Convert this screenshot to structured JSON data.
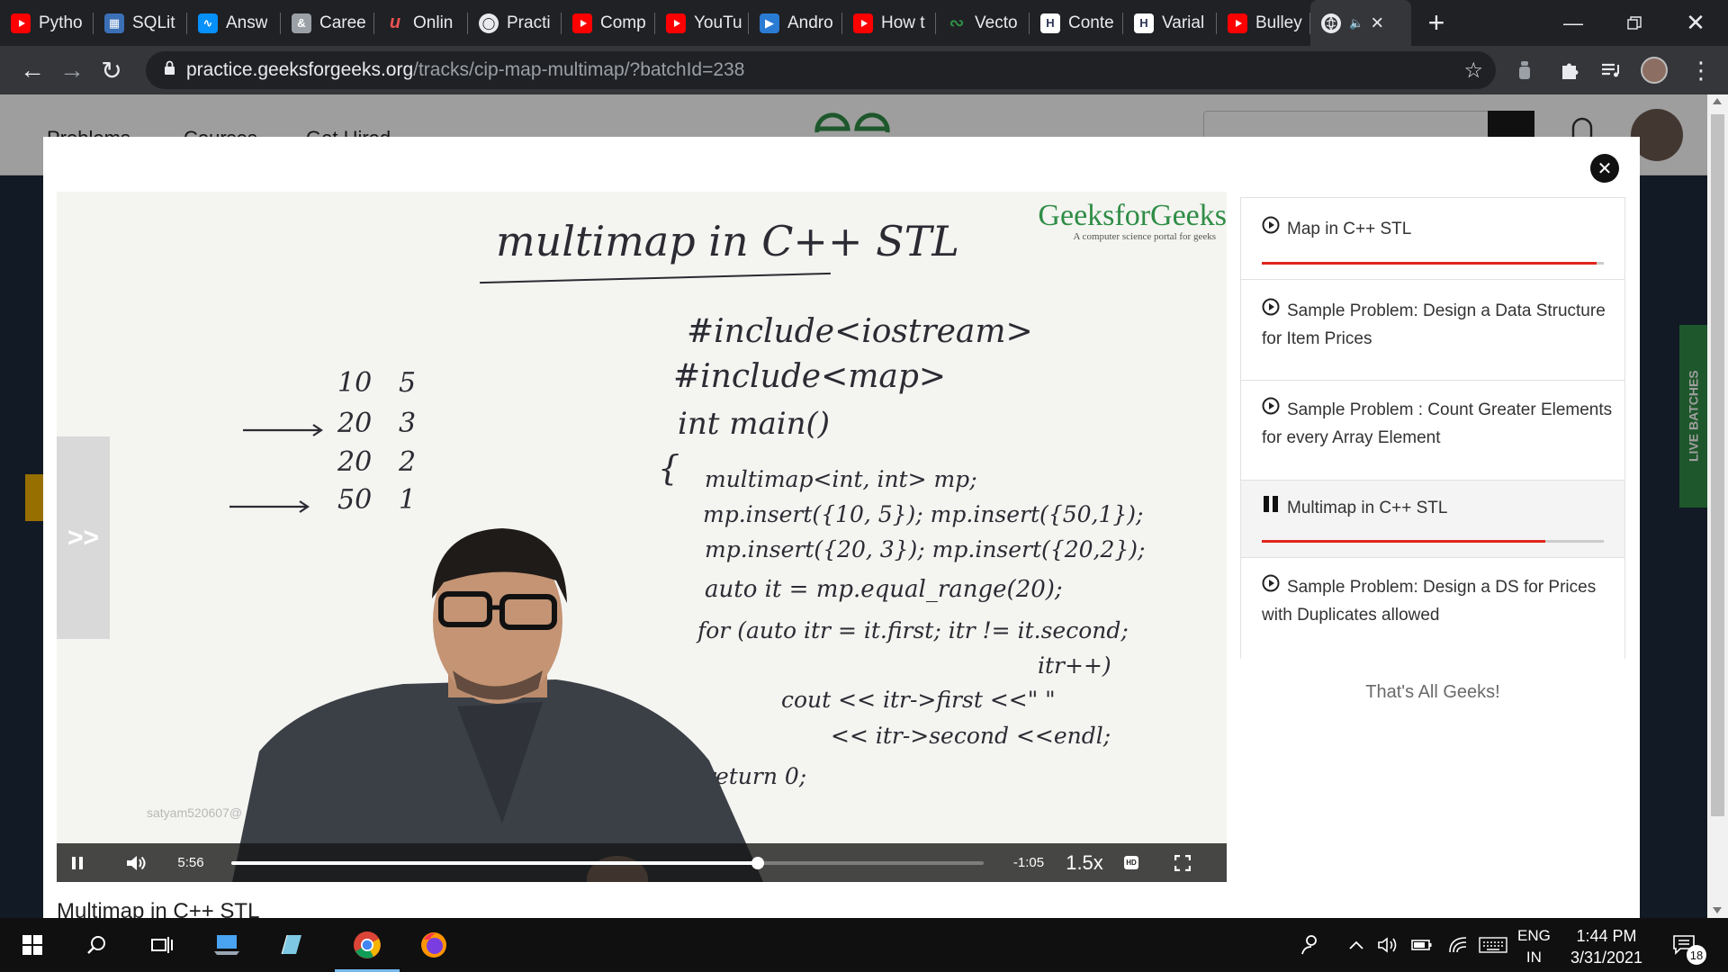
{
  "browser": {
    "tabs": [
      {
        "label": "Pytho",
        "icon": "youtube-icon"
      },
      {
        "label": "SQLit",
        "icon": "sqlite-icon"
      },
      {
        "label": "Answ",
        "icon": "stackshare-icon"
      },
      {
        "label": "Caree",
        "icon": "ampersand-icon"
      },
      {
        "label": "Onlin",
        "icon": "udemy-icon"
      },
      {
        "label": "Practi",
        "icon": "globe-icon"
      },
      {
        "label": "Comp",
        "icon": "youtube-icon"
      },
      {
        "label": "YouTu",
        "icon": "youtube-icon"
      },
      {
        "label": "Andro",
        "icon": "android-studio-icon"
      },
      {
        "label": "How t",
        "icon": "youtube-icon"
      },
      {
        "label": "Vecto",
        "icon": "gfg-icon"
      },
      {
        "label": "Conte",
        "icon": "hackerearth-icon"
      },
      {
        "label": "Varial",
        "icon": "hackerearth-icon"
      },
      {
        "label": "Bulley",
        "icon": "youtube-icon"
      }
    ],
    "active_tab": {
      "icon": "globe-icon",
      "audio_icon": "speaker-icon",
      "close": "×"
    },
    "new_tab": "+",
    "url_host": "practice.geeksforgeeks.org",
    "url_path": "/tracks/cip-map-multimap/?batchId=238"
  },
  "page_behind": {
    "nav": [
      "Problems",
      "Courses",
      "Get Hired"
    ],
    "live_batches": "LIVE BATCHES"
  },
  "player": {
    "elapsed": "5:56",
    "remaining": "-1:05",
    "speed": "1.5x",
    "hd_label": "HD",
    "progress": 0.7,
    "side_tab": ">>",
    "watermark": "satyam520607@",
    "video_title": "Multimap in C++ STL"
  },
  "whiteboard": {
    "brand": "GeeksforGeeks",
    "tagline": "A computer science portal for geeks",
    "title": "multimap in C++ STL",
    "includes": [
      "#include<iostream>",
      "#include<map>"
    ],
    "main": "int main()",
    "brace": "{",
    "code": [
      "multimap<int, int> mp;",
      "mp.insert({10, 5}); mp.insert({50,1});",
      "mp.insert({20, 3}); mp.insert({20,2});",
      "auto it = mp.equal_range(20);",
      "for (auto itr = it.first; itr != it.second;",
      "itr++)",
      "cout << itr->first <<\" \"",
      "<< itr->second <<endl;",
      "return 0;"
    ],
    "table": [
      {
        "k": "10",
        "v": "5",
        "arrow": false
      },
      {
        "k": "20",
        "v": "3",
        "arrow": true
      },
      {
        "k": "20",
        "v": "2",
        "arrow": false
      },
      {
        "k": "50",
        "v": "1",
        "arrow": true
      }
    ]
  },
  "playlist": {
    "items": [
      {
        "title": "Map in C++ STL",
        "state": "watched",
        "progress": 0.98
      },
      {
        "title": "Sample Problem: Design a Data Structure for Item Prices",
        "state": "unwatched"
      },
      {
        "title": "Sample Problem : Count Greater Elements for every Array Element",
        "state": "unwatched"
      },
      {
        "title": "Multimap in C++ STL",
        "state": "playing",
        "progress": 0.83
      },
      {
        "title": "Sample Problem: Design a DS for Prices with Duplicates allowed",
        "state": "unwatched"
      }
    ],
    "footer": "That's All Geeks!"
  },
  "taskbar": {
    "lang_top": "ENG",
    "lang_bottom": "IN",
    "time": "1:44 PM",
    "date": "3/31/2021",
    "notifications": "18"
  },
  "colors": {
    "accent_red": "#e1261c",
    "gfg_green": "#2f8d46",
    "chrome_dark": "#202124"
  }
}
